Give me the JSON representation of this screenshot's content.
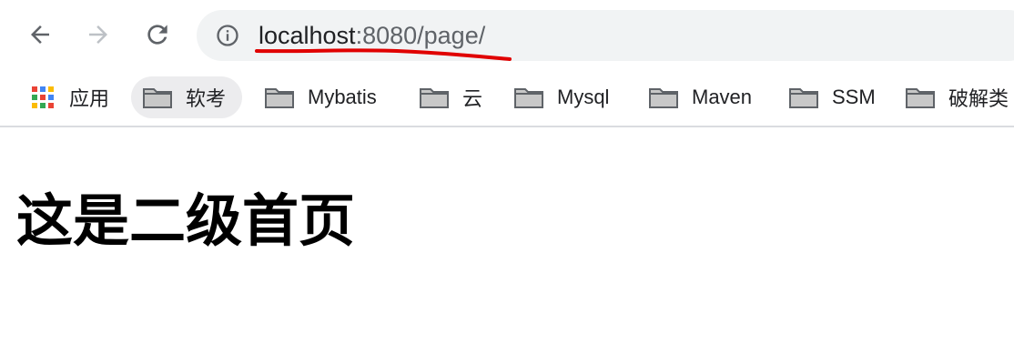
{
  "toolbar": {
    "back_icon": "arrow-left-icon",
    "forward_icon": "arrow-right-icon",
    "reload_icon": "reload-icon",
    "info_icon": "info-icon",
    "url_host": "localhost",
    "url_rest": ":8080/page/",
    "annotation_color": "#e00000"
  },
  "bookmarks": {
    "apps_label": "应用",
    "items": [
      {
        "label": "软考",
        "icon": "folder-icon"
      },
      {
        "label": "Mybatis",
        "icon": "folder-icon"
      },
      {
        "label": "云",
        "icon": "folder-icon"
      },
      {
        "label": "Mysql",
        "icon": "folder-icon"
      },
      {
        "label": "Maven",
        "icon": "folder-icon"
      },
      {
        "label": "SSM",
        "icon": "folder-icon"
      },
      {
        "label": "破解类",
        "icon": "folder-icon"
      }
    ]
  },
  "page": {
    "heading": "这是二级首页"
  }
}
